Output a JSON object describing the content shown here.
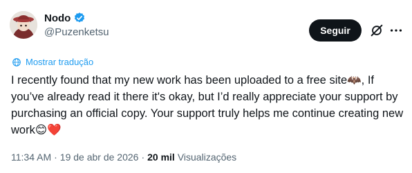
{
  "author": {
    "display_name": "Nodo",
    "handle": "@Puzenketsu"
  },
  "actions": {
    "follow_label": "Seguir"
  },
  "translate": {
    "label": "Mostrar tradução"
  },
  "tweet": {
    "text": "I recently found that my new work has been uploaded to a free site🦇, If you’ve already read it there it's okay, but I’d really appreciate your support by purchasing an official copy. Your support truly helps me continue creating new work😊❤️"
  },
  "meta": {
    "time": "11:34 AM",
    "date": "19 de abr de 2026",
    "views_count": "20 mil",
    "views_label": "Visualizações"
  },
  "colors": {
    "accent": "#1d9bf0",
    "text": "#0f1419",
    "secondary": "#536471"
  }
}
